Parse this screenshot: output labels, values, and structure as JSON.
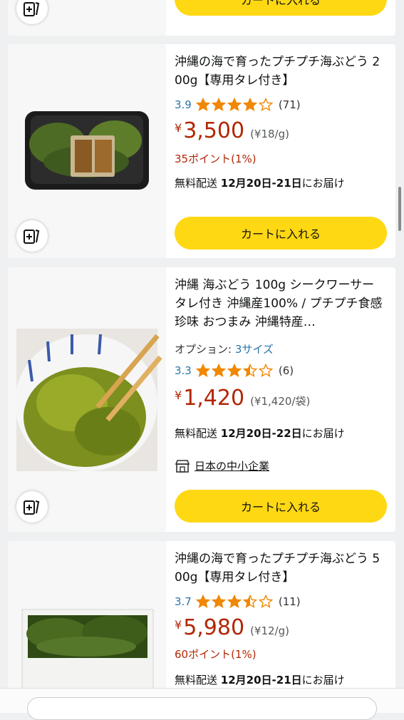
{
  "product_partial": {
    "cart_label": "カートに入れる"
  },
  "products": [
    {
      "title": "沖縄の海で育ったプチプチ海ぶどう 200g【専用タレ付き】",
      "rating": "3.9",
      "rating_value": 3.9,
      "review_count": "(71)",
      "yen": "¥",
      "price": "3,500",
      "unit_price": "(¥18/g)",
      "points": "35ポイント(1%)",
      "delivery_prefix": "無料配送",
      "delivery_date": "12月20日-21日",
      "delivery_suffix": "にお届け",
      "cart_label": "カートに入れる"
    },
    {
      "title": "沖縄 海ぶどう 100g シークワーサー タレ付き 沖縄産100% / プチプチ食感 珍味 おつまみ 沖縄特産…",
      "option_label": "オプション: ",
      "option_link": "3サイズ",
      "rating": "3.3",
      "rating_value": 3.3,
      "review_count": "(6)",
      "yen": "¥",
      "price": "1,420",
      "unit_price": "(¥1,420/袋)",
      "delivery_prefix": "無料配送",
      "delivery_date": "12月20日-22日",
      "delivery_suffix": "にお届け",
      "badge": "日本の中小企業",
      "cart_label": "カートに入れる"
    },
    {
      "title": "沖縄の海で育ったプチプチ海ぶどう 500g【専用タレ付き】",
      "rating": "3.7",
      "rating_value": 3.7,
      "review_count": "(11)",
      "yen": "¥",
      "price": "5,980",
      "unit_price": "(¥12/g)",
      "points": "60ポイント(1%)",
      "delivery_prefix": "無料配送",
      "delivery_date": "12月20日-21日",
      "delivery_suffix": "にお届け"
    }
  ],
  "colors": {
    "accent_yellow": "#ffd814",
    "price_red": "#b12704",
    "star_orange": "#f08804",
    "link_blue": "#2a75a8"
  }
}
